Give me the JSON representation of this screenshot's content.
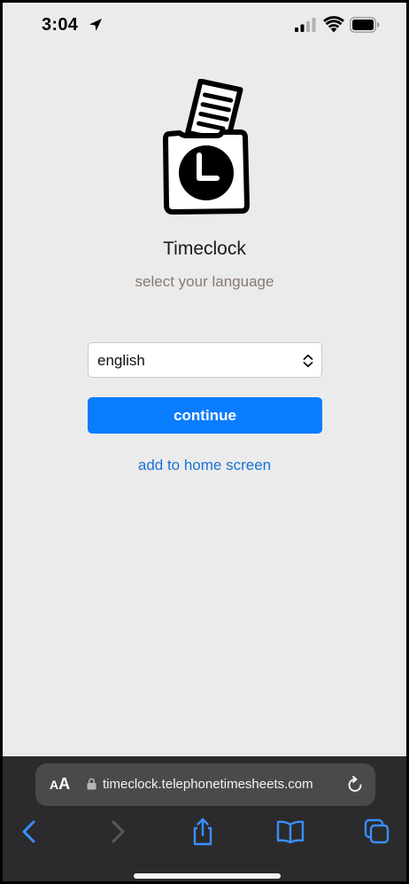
{
  "status_bar": {
    "time": "3:04",
    "icons": [
      "location-arrow-icon",
      "cellular-signal-icon",
      "wifi-icon",
      "battery-icon"
    ]
  },
  "app": {
    "logo_icon": "timeclock-logo-icon",
    "title": "Timeclock",
    "subtitle": "select your language",
    "language_select": {
      "selected": "english",
      "icon": "chevron-updown-icon"
    },
    "continue_label": "continue",
    "home_screen_link": "add to home screen"
  },
  "browser": {
    "text_size_label_small": "A",
    "text_size_label_large": "A",
    "url": "timeclock.telephonetimesheets.com",
    "toolbar_icons": [
      "back-icon",
      "forward-icon",
      "share-icon",
      "bookmarks-icon",
      "tabs-icon"
    ]
  },
  "colors": {
    "page_background": "#ebebeb",
    "accent": "#0a7cff",
    "link": "#1a72d6",
    "subtitle": "#8a7a70",
    "chrome_background": "#2b2b2d",
    "address_bar": "#4a4a4c"
  }
}
